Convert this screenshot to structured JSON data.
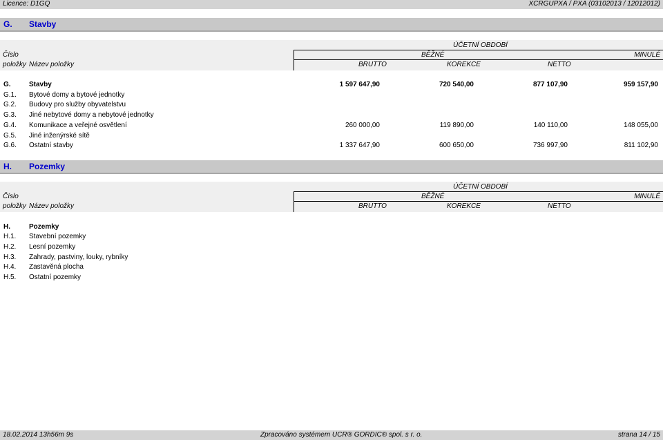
{
  "header": {
    "licence": "Licence: D1GQ",
    "report_id": "XCRGUPXA / PXA  (03102013 / 12012012)"
  },
  "columns": {
    "cislo": "Číslo",
    "polozky": "položky",
    "nazev": "Název položky",
    "obdobi": "ÚČETNÍ OBDOBÍ",
    "bezne": "BĚŽNÉ",
    "minule": "MINULÉ",
    "brutto": "BRUTTO",
    "korekce": "KOREKCE",
    "netto": "NETTO"
  },
  "section_g": {
    "code": "G.",
    "title": "Stavby",
    "rows": [
      {
        "code": "G.",
        "name": "Stavby",
        "brutto": "1 597 647,90",
        "korekce": "720 540,00",
        "netto": "877 107,90",
        "minule": "959 157,90",
        "bold": true
      },
      {
        "code": "G.1.",
        "name": "Bytové domy a bytové jednotky",
        "brutto": "",
        "korekce": "",
        "netto": "",
        "minule": ""
      },
      {
        "code": "G.2.",
        "name": "Budovy pro služby obyvatelstvu",
        "brutto": "",
        "korekce": "",
        "netto": "",
        "minule": ""
      },
      {
        "code": "G.3.",
        "name": "Jiné nebytové domy a nebytové jednotky",
        "brutto": "",
        "korekce": "",
        "netto": "",
        "minule": ""
      },
      {
        "code": "G.4.",
        "name": "Komunikace a veřejné osvětlení",
        "brutto": "260 000,00",
        "korekce": "119 890,00",
        "netto": "140 110,00",
        "minule": "148 055,00"
      },
      {
        "code": "G.5.",
        "name": "Jiné inženýrské sítě",
        "brutto": "",
        "korekce": "",
        "netto": "",
        "minule": ""
      },
      {
        "code": "G.6.",
        "name": "Ostatní stavby",
        "brutto": "1 337 647,90",
        "korekce": "600 650,00",
        "netto": "736 997,90",
        "minule": "811 102,90"
      }
    ]
  },
  "section_h": {
    "code": "H.",
    "title": "Pozemky",
    "rows": [
      {
        "code": "H.",
        "name": "Pozemky",
        "bold": true
      },
      {
        "code": "H.1.",
        "name": "Stavební pozemky"
      },
      {
        "code": "H.2.",
        "name": "Lesní pozemky"
      },
      {
        "code": "H.3.",
        "name": "Zahrady, pastviny, louky, rybníky"
      },
      {
        "code": "H.4.",
        "name": "Zastavěná plocha"
      },
      {
        "code": "H.5.",
        "name": "Ostatní pozemky"
      }
    ]
  },
  "footer": {
    "timestamp": "18.02.2014 13h56m 9s",
    "processed": "Zpracováno systémem UCR® GORDIC® spol. s  r. o.",
    "page": "strana 14 / 15"
  }
}
